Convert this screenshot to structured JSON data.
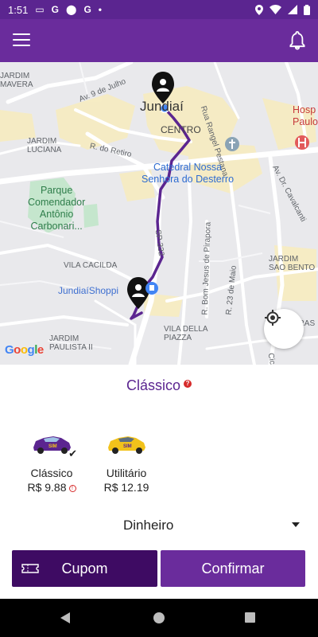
{
  "status_bar": {
    "time": "1:51",
    "left_icons": [
      "sim-icon",
      "google-g-icon",
      "location-pin-icon",
      "google-g-icon",
      "dot-icon"
    ],
    "right_icons": [
      "location-icon",
      "wifi-icon",
      "signal-icon",
      "battery-icon"
    ]
  },
  "app_bar": {
    "menu_icon": "hamburger-icon",
    "notification_icon": "bell-icon"
  },
  "map": {
    "city": "Jundiaí",
    "labels": {
      "jardim_mavera": "JARDIM\nMAVERA",
      "av_9_julho": "Av. 9 de Julho",
      "rua_rangel": "Rua Rangel Pestana",
      "centro": "CENTRO",
      "hospital": "Hosp\nPaulo",
      "jardim_luciana": "JARDIM\nLUCIANA",
      "r_retiro": "R. do Retiro",
      "catedral": "Catedral Nossa\nSenhora do Desterro",
      "av_cavalcanti": "Av. Dr. Cavalcanti",
      "parque": "Parque\nComendador\nAntônio\nCarbonari...",
      "sp332": "SP-332",
      "r_bom_jesus": "R. Bom Jesus de Pirapora",
      "r_23_maio": "R. 23 de Maio",
      "jardim_sao_bento": "JARDIM\nSAO BENTO",
      "vila_cacilda": "VILA CACILDA",
      "shopping": "JundiaíShoppi",
      "vila_della_piazza": "VILA DELLA\nPIAZZA",
      "jardim_paulista": "JARDIM\nPAULISTA II",
      "vitras": "VITRAS",
      "cica": "Cica"
    },
    "google_logo": "Google",
    "locate_icon": "my-location-icon"
  },
  "ride": {
    "selected_category": "Clássico",
    "options": [
      {
        "name": "Clássico",
        "price": "R$ 9.88",
        "selected": true,
        "car_color": "#5b2590",
        "info_icon": true
      },
      {
        "name": "Utilitário",
        "price": "R$ 12.19",
        "selected": false,
        "car_color": "#f2c21b",
        "info_icon": false
      }
    ]
  },
  "payment": {
    "method": "Dinheiro"
  },
  "actions": {
    "coupon": "Cupom",
    "confirm": "Confirmar"
  },
  "colors": {
    "primary": "#6a2c9c",
    "primary_dark": "#3e0b63",
    "route": "#5b2590",
    "alert": "#d62b2b"
  }
}
